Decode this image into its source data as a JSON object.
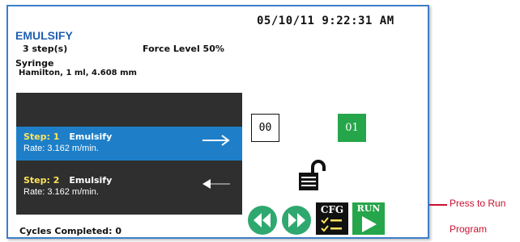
{
  "header": {
    "datetime": "05/10/11 9:22:31 AM",
    "program_name": "EMULSIFY",
    "steps_count": "3 step(s)",
    "force_level": "Force Level 50%",
    "syringe_label": "Syringe",
    "syringe_value": "Hamilton, 1 ml, 4.608 mm"
  },
  "steps": [
    {
      "tag": "Step: 1",
      "name": "Emulsify",
      "rate": "Rate: 3.162 m/min.",
      "direction": "right",
      "active": true
    },
    {
      "tag": "Step: 2",
      "name": "Emulsify",
      "rate": "Rate: 3.162 m/min.",
      "direction": "left",
      "active": false
    }
  ],
  "counters": {
    "start": "00",
    "end": "01"
  },
  "buttons": {
    "cfg": "CFG",
    "run": "RUN"
  },
  "footer": {
    "cycles": "Cycles Completed: 0"
  },
  "callout": {
    "line1": "Press to Run",
    "line2": "Program"
  },
  "colors": {
    "accent_blue": "#1e7fc8",
    "green": "#26a64a",
    "step_tag": "#ffe45c",
    "callout": "#c8102e",
    "frame": "#3d7fc9"
  }
}
